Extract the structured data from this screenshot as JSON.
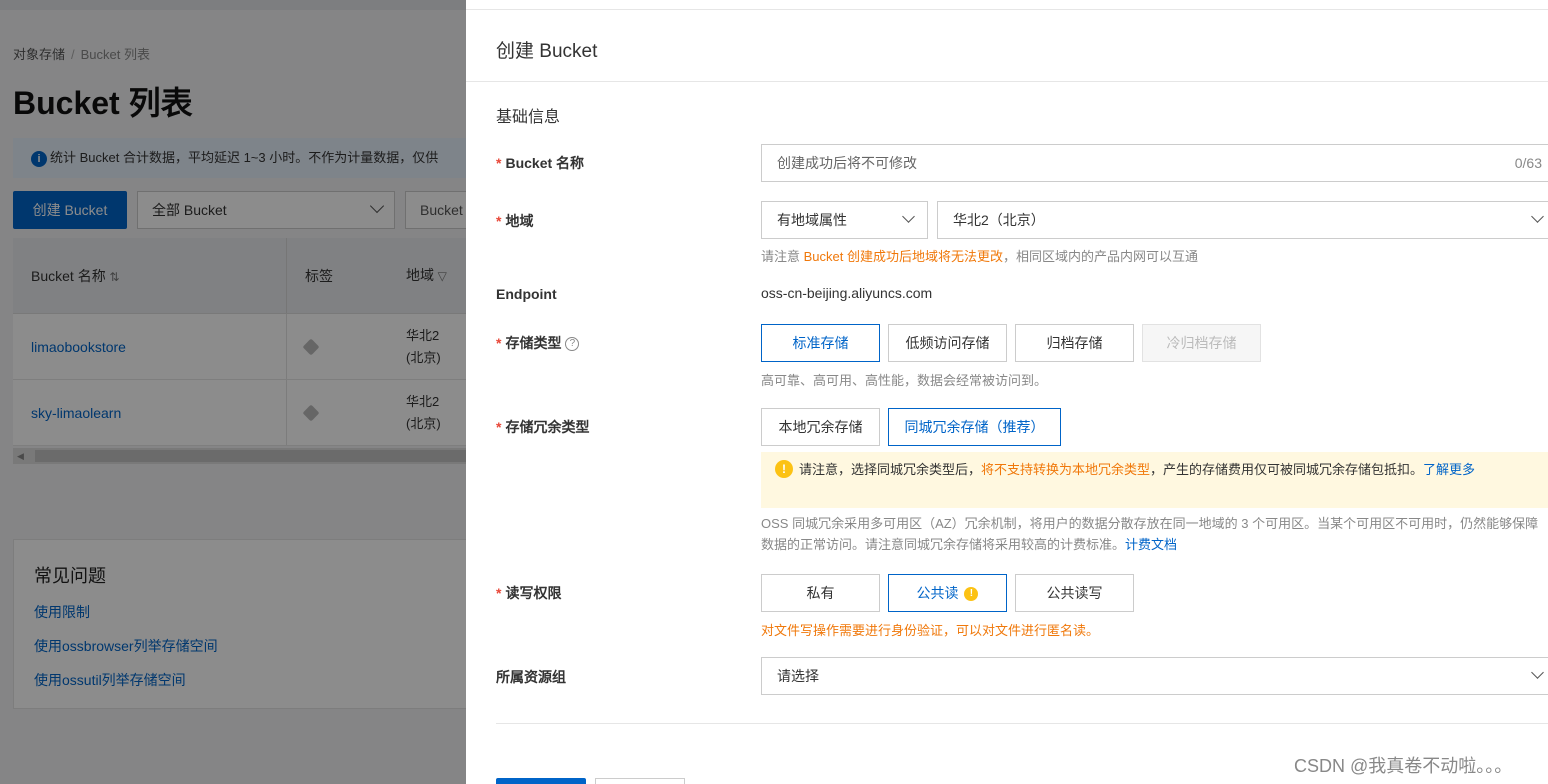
{
  "background": {
    "breadcrumb": {
      "root": "对象存储",
      "separator": "/",
      "current": "Bucket 列表"
    },
    "page_title": "Bucket 列表",
    "info_banner": "统计 Bucket 合计数据，平均延迟 1~3 小时。不作为计量数据，仅供",
    "create_button": "创建 Bucket",
    "filter_select": "全部 Bucket",
    "search_prefix": "Bucket",
    "table": {
      "headers": {
        "name": "Bucket 名称",
        "tags": "标签",
        "region": "地域"
      },
      "rows": [
        {
          "name": "limaobookstore",
          "region_line1": "华北2",
          "region_line2": "(北京)"
        },
        {
          "name": "sky-limaolearn",
          "region_line1": "华北2",
          "region_line2": "(北京)"
        }
      ]
    },
    "faq": {
      "title": "常见问题",
      "links": [
        "使用限制",
        "使用ossbrowser列举存储空间",
        "使用ossutil列举存储空间"
      ]
    }
  },
  "drawer": {
    "title": "创建 Bucket",
    "section": "基础信息",
    "required_mark": "*",
    "bucket_name": {
      "label": "Bucket 名称",
      "placeholder": "创建成功后将不可修改",
      "counter": "0/63"
    },
    "region": {
      "label": "地域",
      "type_value": "有地域属性",
      "region_value": "华北2（北京）",
      "help_prefix": "请注意 ",
      "help_orange": "Bucket 创建成功后地域将无法更改",
      "help_suffix": "，相同区域内的产品内网可以互通"
    },
    "endpoint": {
      "label": "Endpoint",
      "value": "oss-cn-beijing.aliyuncs.com"
    },
    "storage_class": {
      "label": "存储类型",
      "help_icon": "?",
      "options": [
        "标准存储",
        "低频访问存储",
        "归档存储",
        "冷归档存储"
      ],
      "help": "高可靠、高可用、高性能，数据会经常被访问到。"
    },
    "redundancy": {
      "label": "存储冗余类型",
      "options": [
        "本地冗余存储",
        "同城冗余存储（推荐）"
      ],
      "warning_icon": "!",
      "warning_prefix": "请注意，选择同城冗余类型后，",
      "warning_orange": "将不支持转换为本地冗余类型",
      "warning_suffix": "，产生的存储费用仅可被同城冗余存储包抵扣。",
      "warning_link": "了解更多",
      "help_text": "OSS 同城冗余采用多可用区（AZ）冗余机制，将用户的数据分散存放在同一地域的 3 个可用区。当某个可用区不可用时，仍然能够保障数据的正常访问。请注意同城冗余存储将采用较高的计费标准。",
      "help_link": "计费文档"
    },
    "acl": {
      "label": "读写权限",
      "options": [
        "私有",
        "公共读",
        "公共读写"
      ],
      "warning_icon": "!",
      "help": "对文件写操作需要进行身份验证，可以对文件进行匿名读。"
    },
    "resource_group": {
      "label": "所属资源组",
      "placeholder": "请选择"
    }
  },
  "watermark": "CSDN @我真卷不动啦。。。"
}
